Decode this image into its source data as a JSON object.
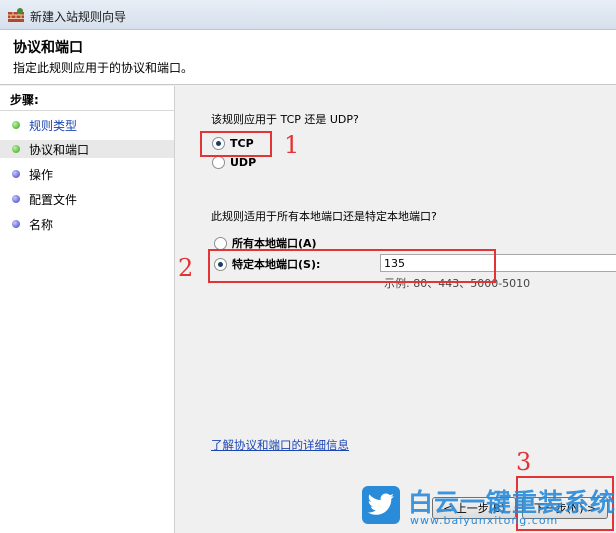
{
  "window": {
    "title": "新建入站规则向导",
    "icon": "firewall-wizard-icon"
  },
  "header": {
    "title": "协议和端口",
    "description": "指定此规则应用于的协议和端口。"
  },
  "sidebar": {
    "label": "步骤:",
    "items": [
      {
        "label": "规则类型",
        "state": "completed",
        "dot_color": "#3a9e1e"
      },
      {
        "label": "协议和端口",
        "state": "current",
        "dot_color": "#3a9e1e"
      },
      {
        "label": "操作",
        "state": "pending",
        "dot_color": "#3c3cbf"
      },
      {
        "label": "配置文件",
        "state": "pending",
        "dot_color": "#3c3cbf"
      },
      {
        "label": "名称",
        "state": "pending",
        "dot_color": "#3c3cbf"
      }
    ]
  },
  "protocol": {
    "question": "该规则应用于 TCP 还是 UDP?",
    "options": [
      {
        "label": "TCP",
        "selected": true
      },
      {
        "label": "UDP",
        "selected": false
      }
    ]
  },
  "ports": {
    "question": "此规则适用于所有本地端口还是特定本地端口?",
    "all_label": "所有本地端口(A)",
    "specific_label": "特定本地端口(S):",
    "selected": "specific",
    "value": "135",
    "example": "示例: 80、443、5000-5010"
  },
  "learn_more_link": "了解协议和端口的详细信息",
  "buttons": {
    "back": "< 上一步(B)",
    "next": "下一步(N) >"
  },
  "annotations": {
    "color": "#e23434",
    "labels": [
      "1",
      "2",
      "3"
    ]
  },
  "watermark": {
    "name": "白云一键重装系统",
    "url": "www.baiyunxitong.com",
    "color": "#2a8bd8"
  }
}
